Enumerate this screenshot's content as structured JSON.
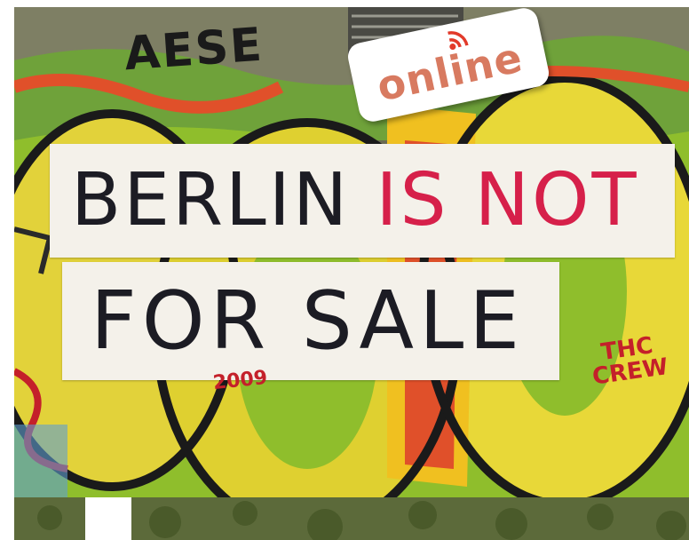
{
  "sign_line_1": {
    "part_dark": "BERLIN ",
    "part_red": "IS NOT"
  },
  "sign_line_2": {
    "text": "FOR SALE"
  },
  "badge": {
    "label": "online",
    "icon": "wifi-signal-icon"
  },
  "graffiti": {
    "top_tag": "AESE",
    "year": "2009",
    "crew": "THC CREW"
  },
  "colors": {
    "sign_ink": "#1c1c24",
    "sign_red": "#d6204a",
    "badge_text": "#d87a60",
    "badge_icon": "#e23a2a"
  }
}
